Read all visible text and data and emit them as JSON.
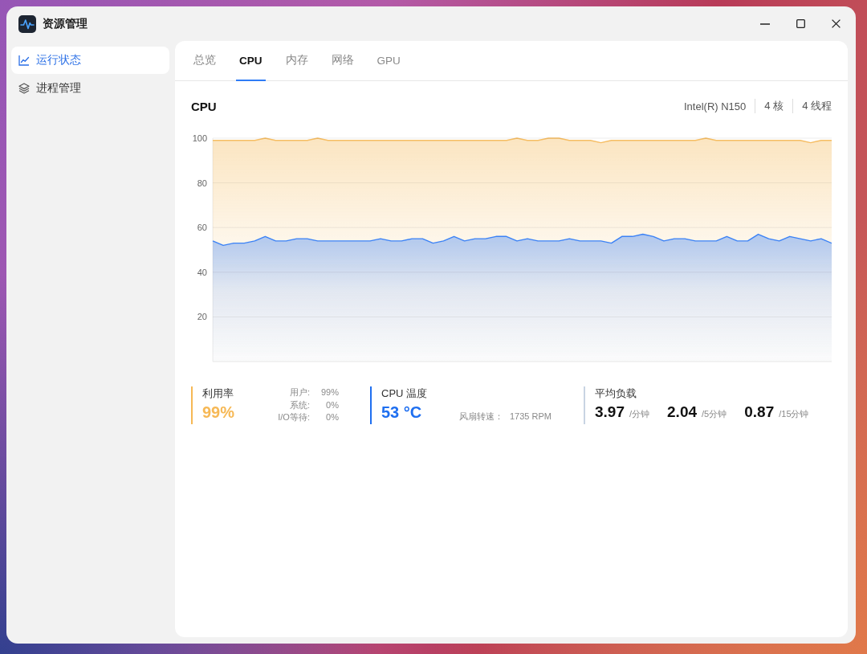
{
  "window": {
    "title": "资源管理"
  },
  "sidebar": {
    "items": [
      {
        "label": "运行状态",
        "selected": true
      },
      {
        "label": "进程管理",
        "selected": false
      }
    ]
  },
  "tabs": [
    {
      "label": "总览",
      "selected": false
    },
    {
      "label": "CPU",
      "selected": true
    },
    {
      "label": "内存",
      "selected": false
    },
    {
      "label": "网络",
      "selected": false
    },
    {
      "label": "GPU",
      "selected": false
    }
  ],
  "cpu_panel": {
    "title": "CPU",
    "specs": [
      "Intel(R) N150",
      "4 核",
      "4 线程"
    ],
    "chart_data": [
      {
        "type": "area",
        "ylim": [
          0,
          100
        ],
        "yticks": [
          20,
          40,
          60,
          80,
          100
        ],
        "tick_labels": "y",
        "grid": true,
        "series": [
          {
            "color": "#f6bd63",
            "values": [
              99,
              99,
              99,
              99,
              99,
              100,
              99,
              99,
              99,
              99,
              100,
              99,
              99,
              99,
              99,
              99,
              99,
              99,
              99,
              99,
              99,
              99,
              99,
              99,
              99,
              99,
              99,
              99,
              99,
              100,
              99,
              99,
              100,
              100,
              99,
              99,
              99,
              98,
              99,
              99,
              99,
              99,
              99,
              99,
              99,
              99,
              99,
              100,
              99,
              99,
              99,
              99,
              99,
              99,
              99,
              99,
              99,
              98,
              99,
              99
            ]
          },
          {
            "color": "#3b82f6",
            "values": [
              54,
              52,
              53,
              53,
              54,
              56,
              54,
              54,
              55,
              55,
              54,
              54,
              54,
              54,
              54,
              54,
              55,
              54,
              54,
              55,
              55,
              53,
              54,
              56,
              54,
              55,
              55,
              56,
              56,
              54,
              55,
              54,
              54,
              54,
              55,
              54,
              54,
              54,
              53,
              56,
              56,
              57,
              56,
              54,
              55,
              55,
              54,
              54,
              54,
              56,
              54,
              54,
              57,
              55,
              54,
              56,
              55,
              54,
              55,
              53
            ]
          }
        ]
      }
    ],
    "stats": [
      {
        "kind": "usage",
        "label": "利用率",
        "value": "99%",
        "color": "#f6b855",
        "breakdown": [
          {
            "label": "用户:",
            "value": "99%"
          },
          {
            "label": "系统:",
            "value": "0%"
          },
          {
            "label": "I/O等待:",
            "value": "0%"
          }
        ]
      },
      {
        "kind": "temperature",
        "label": "CPU 温度",
        "value": "53 °C",
        "color": "#1f6ff0",
        "fan": {
          "label": "风扇转速：",
          "value": "1735 RPM"
        }
      },
      {
        "kind": "load",
        "label": "平均负载",
        "color": "#c8d4e3",
        "readings": [
          {
            "value": "3.97",
            "unit": "/分钟"
          },
          {
            "value": "2.04",
            "unit": "/5分钟"
          },
          {
            "value": "0.87",
            "unit": "/15分钟"
          }
        ]
      }
    ]
  }
}
